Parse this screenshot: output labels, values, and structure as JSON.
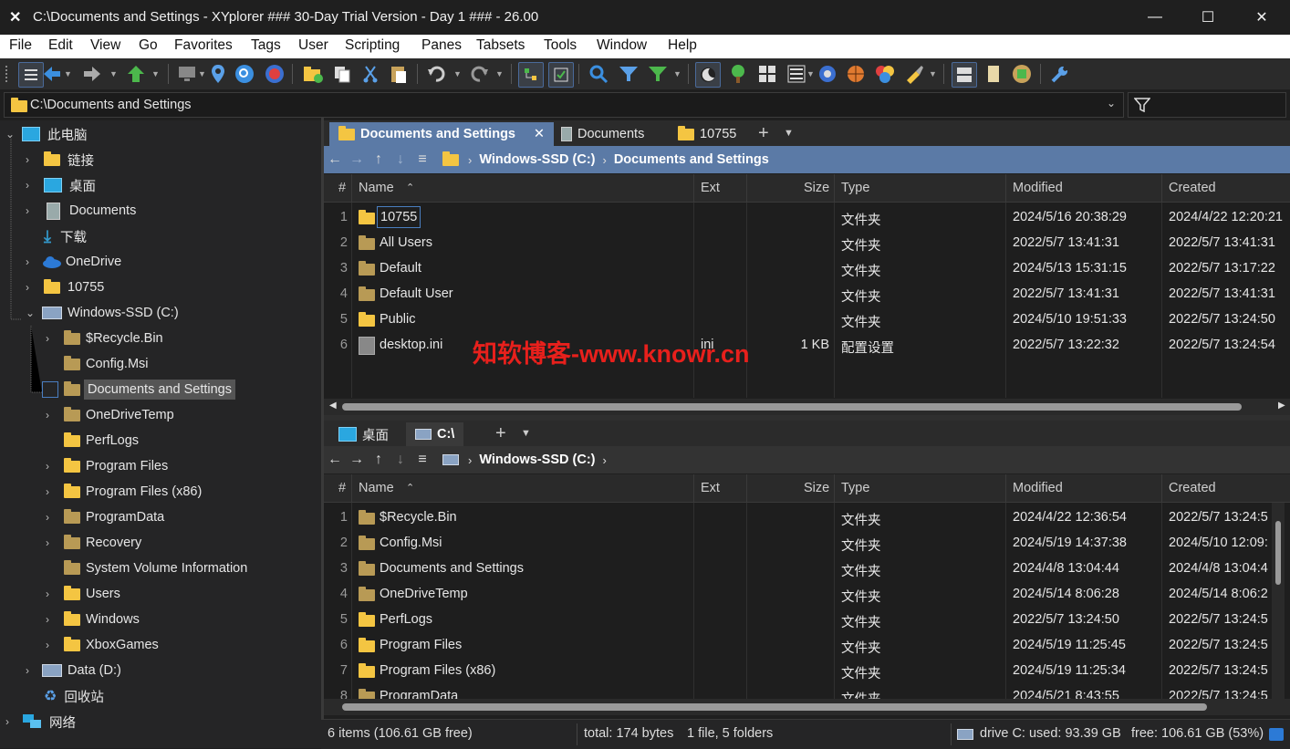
{
  "window": {
    "title": "C:\\Documents and Settings - XYplorer ### 30-Day Trial Version - Day 1 ### - 26.00",
    "min": "—",
    "max": "☐",
    "close": "✕"
  },
  "menu": [
    "File",
    "Edit",
    "View",
    "Go",
    "Favorites",
    "Tags",
    "User",
    "Scripting",
    "Panes",
    "Tabsets",
    "Tools",
    "Window",
    "Help"
  ],
  "address": {
    "path": "C:\\Documents and Settings"
  },
  "tree": [
    {
      "label": "此电脑",
      "icon": "pc-icon"
    },
    {
      "label": "链接",
      "icon": "folder-icon"
    },
    {
      "label": "桌面",
      "icon": "desktop-icon"
    },
    {
      "label": "Documents",
      "icon": "document-icon"
    },
    {
      "label": "下载",
      "icon": "download-icon"
    },
    {
      "label": "OneDrive",
      "icon": "cloud-icon"
    },
    {
      "label": "10755",
      "icon": "folder-icon"
    },
    {
      "label": "Windows-SSD (C:)",
      "icon": "drive-icon"
    },
    {
      "label": "$Recycle.Bin",
      "icon": "folder-icon"
    },
    {
      "label": "Config.Msi",
      "icon": "folder-icon"
    },
    {
      "label": "Documents and Settings",
      "icon": "folder-link-icon"
    },
    {
      "label": "OneDriveTemp",
      "icon": "folder-icon"
    },
    {
      "label": "PerfLogs",
      "icon": "folder-icon"
    },
    {
      "label": "Program Files",
      "icon": "folder-icon"
    },
    {
      "label": "Program Files (x86)",
      "icon": "folder-icon"
    },
    {
      "label": "ProgramData",
      "icon": "folder-icon"
    },
    {
      "label": "Recovery",
      "icon": "folder-icon"
    },
    {
      "label": "System Volume Information",
      "icon": "folder-icon"
    },
    {
      "label": "Users",
      "icon": "folder-icon"
    },
    {
      "label": "Windows",
      "icon": "folder-icon"
    },
    {
      "label": "XboxGames",
      "icon": "folder-icon"
    },
    {
      "label": "Data (D:)",
      "icon": "drive-icon"
    },
    {
      "label": "回收站",
      "icon": "recycle-bin-icon"
    },
    {
      "label": "网络",
      "icon": "network-icon"
    }
  ],
  "pane1": {
    "tabs": [
      "Documents and Settings",
      "Documents",
      "10755"
    ],
    "crumbs": [
      "Windows-SSD (C:)",
      "Documents and Settings"
    ],
    "columns": {
      "num": "#",
      "name": "Name",
      "ext": "Ext",
      "size": "Size",
      "type": "Type",
      "modified": "Modified",
      "created": "Created"
    },
    "rows": [
      {
        "n": "1",
        "name": "10755",
        "ext": "",
        "size": "",
        "type": "文件夹",
        "modified": "2024/5/16 20:38:29",
        "created": "2024/4/22 12:20:21"
      },
      {
        "n": "2",
        "name": "All Users",
        "ext": "",
        "size": "",
        "type": "文件夹",
        "modified": "2022/5/7 13:41:31",
        "created": "2022/5/7 13:41:31"
      },
      {
        "n": "3",
        "name": "Default",
        "ext": "",
        "size": "",
        "type": "文件夹",
        "modified": "2024/5/13 15:31:15",
        "created": "2022/5/7 13:17:22"
      },
      {
        "n": "4",
        "name": "Default User",
        "ext": "",
        "size": "",
        "type": "文件夹",
        "modified": "2022/5/7 13:41:31",
        "created": "2022/5/7 13:41:31"
      },
      {
        "n": "5",
        "name": "Public",
        "ext": "",
        "size": "",
        "type": "文件夹",
        "modified": "2024/5/10 19:51:33",
        "created": "2022/5/7 13:24:50"
      },
      {
        "n": "6",
        "name": "desktop.ini",
        "ext": "ini",
        "size": "1 KB",
        "type": "配置设置",
        "modified": "2022/5/7 13:22:32",
        "created": "2022/5/7 13:24:54"
      }
    ]
  },
  "pane2": {
    "tabs": [
      "桌面",
      "C:\\"
    ],
    "crumbs": [
      "Windows-SSD (C:)"
    ],
    "columns": {
      "num": "#",
      "name": "Name",
      "ext": "Ext",
      "size": "Size",
      "type": "Type",
      "modified": "Modified",
      "created": "Created"
    },
    "rows": [
      {
        "n": "1",
        "name": "$Recycle.Bin",
        "type": "文件夹",
        "modified": "2024/4/22 12:36:54",
        "created": "2022/5/7 13:24:5"
      },
      {
        "n": "2",
        "name": "Config.Msi",
        "type": "文件夹",
        "modified": "2024/5/19 14:37:38",
        "created": "2024/5/10 12:09:"
      },
      {
        "n": "3",
        "name": "Documents and Settings",
        "type": "文件夹",
        "modified": "2024/4/8 13:04:44",
        "created": "2024/4/8 13:04:4"
      },
      {
        "n": "4",
        "name": "OneDriveTemp",
        "type": "文件夹",
        "modified": "2024/5/14 8:06:28",
        "created": "2024/5/14 8:06:2"
      },
      {
        "n": "5",
        "name": "PerfLogs",
        "type": "文件夹",
        "modified": "2022/5/7 13:24:50",
        "created": "2022/5/7 13:24:5"
      },
      {
        "n": "6",
        "name": "Program Files",
        "type": "文件夹",
        "modified": "2024/5/19 11:25:45",
        "created": "2022/5/7 13:24:5"
      },
      {
        "n": "7",
        "name": "Program Files (x86)",
        "type": "文件夹",
        "modified": "2024/5/19 11:25:34",
        "created": "2022/5/7 13:24:5"
      },
      {
        "n": "8",
        "name": "ProgramData",
        "type": "文件夹",
        "modified": "2024/5/21 8:43:55",
        "created": "2022/5/7 13:24:5"
      }
    ]
  },
  "status": {
    "items": "6 items (106.61 GB free)",
    "total": "total: 174 bytes",
    "counts": "1 file, 5 folders",
    "drive": "drive C:  used: 93.39 GB",
    "free": "free: 106.61 GB (53%)"
  },
  "watermark": "知软博客-www.knowr.cn",
  "colors": {
    "accent": "#5b7aa6",
    "folder": "#f4c542",
    "watermark": "#e8201c"
  }
}
